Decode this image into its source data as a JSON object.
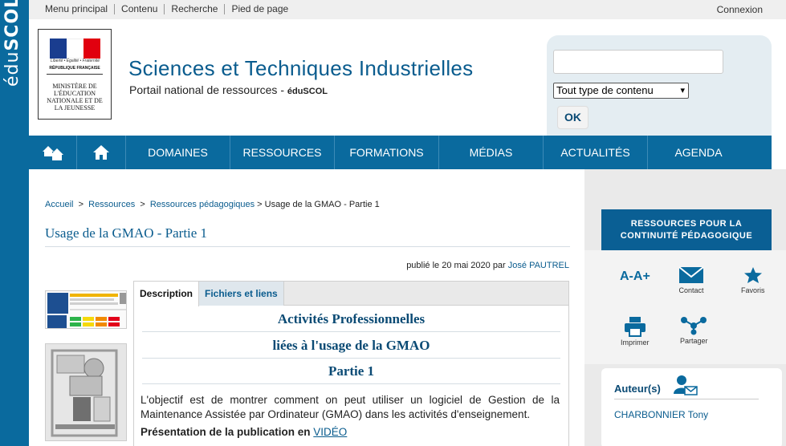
{
  "brand": {
    "vertical_text_light": "édu",
    "vertical_text_bold": "SCOL"
  },
  "topbar": {
    "links": [
      "Menu principal",
      "Contenu",
      "Recherche",
      "Pied de page"
    ],
    "connexion": "Connexion"
  },
  "logo": {
    "motto": "Liberté • Égalité • Fraternité",
    "republic": "RÉPUBLIQUE FRANÇAISE",
    "ministry": "MINISTÈRE DE L'ÉDUCATION NATIONALE ET DE LA JEUNESSE"
  },
  "header": {
    "title": "Sciences et Techniques Industrielles",
    "subtitle": "Portail national de ressources - ",
    "subtitle_brand": "éduSCOL"
  },
  "search": {
    "value": "",
    "type_selected": "Tout type de contenu",
    "ok_label": "OK"
  },
  "nav": {
    "items": [
      "DOMAINES",
      "RESSOURCES",
      "FORMATIONS",
      "MÉDIAS",
      "ACTUALITÉS",
      "AGENDA"
    ]
  },
  "breadcrumb": {
    "items": [
      "Accueil",
      "Ressources",
      "Ressources pédagogiques"
    ],
    "current": "Usage de la GMAO - Partie 1"
  },
  "page": {
    "title": "Usage de la GMAO - Partie 1",
    "published_prefix": "publié le 20 mai 2020 par ",
    "author_link": "José PAUTREL"
  },
  "tabs": [
    "Description",
    "Fichiers et liens"
  ],
  "content": {
    "heading1": "Activités Professionnelles",
    "heading2": "liées à l'usage de la GMAO",
    "heading3": "Partie 1",
    "objective": "L'objectif est de montrer comment on peut utiliser un logiciel de Gestion de la Maintenance Assistée par Ordinateur (GMAO) dans les activités d'enseignement.",
    "presentation_label": "Présentation de la publication en ",
    "presentation_link": "VIDÉO"
  },
  "sidebar": {
    "banner_line1": "RESSOURCES POUR LA",
    "banner_line2": "CONTINUITÉ PÉDAGOGIQUE",
    "font_size_label": "A-A+",
    "contact_label": "Contact",
    "favoris_label": "Favoris",
    "imprimer_label": "Imprimer",
    "partager_label": "Partager",
    "authors_title": "Auteur(s)",
    "author_name": "CHARBONNIER Tony"
  },
  "colors": {
    "brand_blue": "#0a6a9e",
    "title_blue": "#0a5c8e",
    "sidebar_bg": "#eaeaea"
  }
}
